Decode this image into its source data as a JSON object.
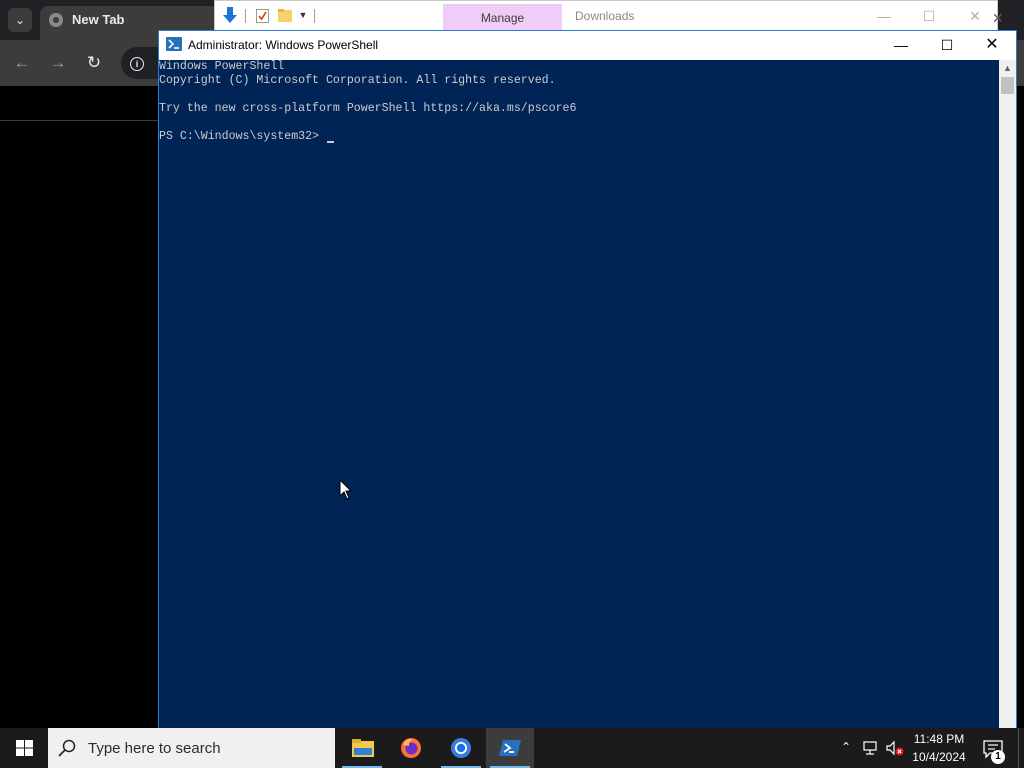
{
  "browser": {
    "tab_title": "New Tab",
    "icons": [
      "tab-search-icon",
      "back-arrow-icon",
      "forward-arrow-icon",
      "reload-icon",
      "site-info-icon"
    ]
  },
  "explorer": {
    "ribbon_manage_label": "Manage",
    "folder_title": "Downloads",
    "manage_tab_color": "#f0cdf6"
  },
  "powershell": {
    "title": "Administrator: Windows PowerShell",
    "console_background": "#012456",
    "console_lines": [
      "Windows PowerShell",
      "Copyright (C) Microsoft Corporation. All rights reserved.",
      "Try the new cross-platform PowerShell https://aka.ms/pscore6",
      "PS C:\\Windows\\system32> "
    ]
  },
  "taskbar": {
    "search_placeholder": "Type here to search",
    "apps": [
      "File Explorer",
      "Firefox",
      "Chrome",
      "Windows PowerShell"
    ],
    "active_app": "Windows PowerShell",
    "clock_time": "11:48 PM",
    "clock_date": "10/4/2024",
    "notification_count": "1"
  }
}
